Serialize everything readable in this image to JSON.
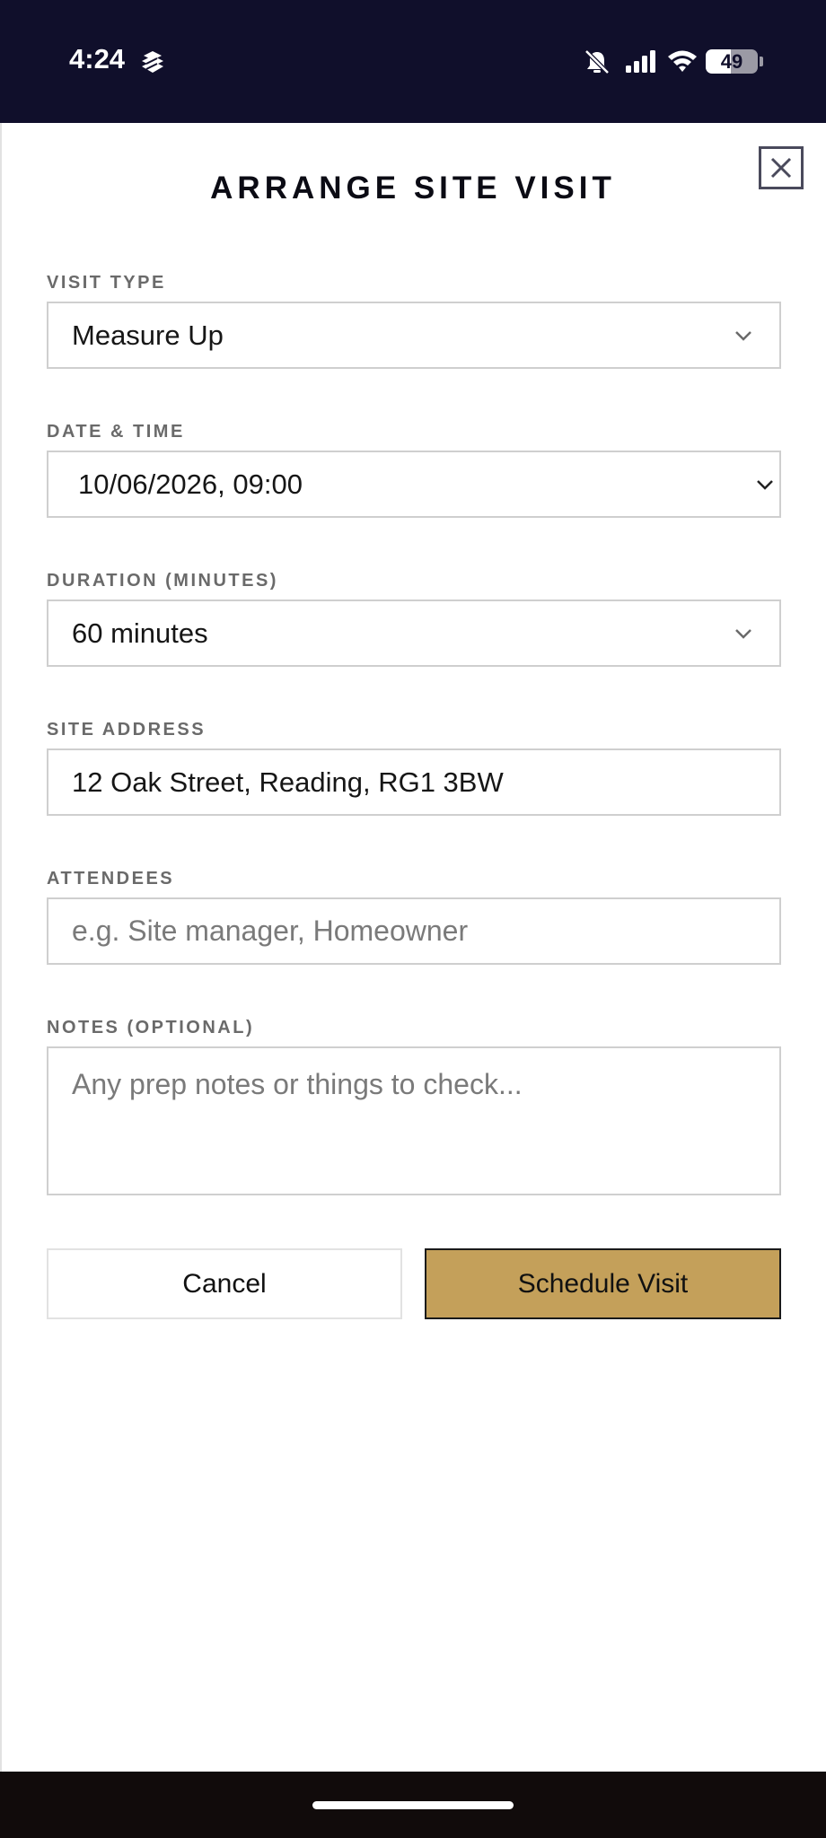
{
  "status_bar": {
    "time": "4:24",
    "battery_level": "49",
    "app_icon": "layers-app-icon",
    "icons": [
      "mute-bell-icon",
      "cellular-signal-icon",
      "wifi-icon",
      "battery-icon"
    ]
  },
  "dialog": {
    "title": "ARRANGE SITE VISIT",
    "close_icon": "close-icon"
  },
  "form": {
    "visit_type": {
      "label": "VISIT TYPE",
      "value": "Measure Up"
    },
    "date_time": {
      "label": "DATE & TIME",
      "value": "10/06/2026, 09:00"
    },
    "duration": {
      "label": "DURATION (MINUTES)",
      "value": "60 minutes"
    },
    "site_address": {
      "label": "SITE ADDRESS",
      "value": "12 Oak Street, Reading, RG1 3BW"
    },
    "attendees": {
      "label": "ATTENDEES",
      "value": "",
      "placeholder": "e.g. Site manager, Homeowner"
    },
    "notes": {
      "label": "NOTES (OPTIONAL)",
      "value": "",
      "placeholder": "Any prep notes or things to check..."
    }
  },
  "actions": {
    "cancel_label": "Cancel",
    "submit_label": "Schedule Visit"
  },
  "colors": {
    "status_bar_bg": "#100f2b",
    "primary_button": "#c4a05a",
    "home_bar_bg": "#110b0b"
  }
}
